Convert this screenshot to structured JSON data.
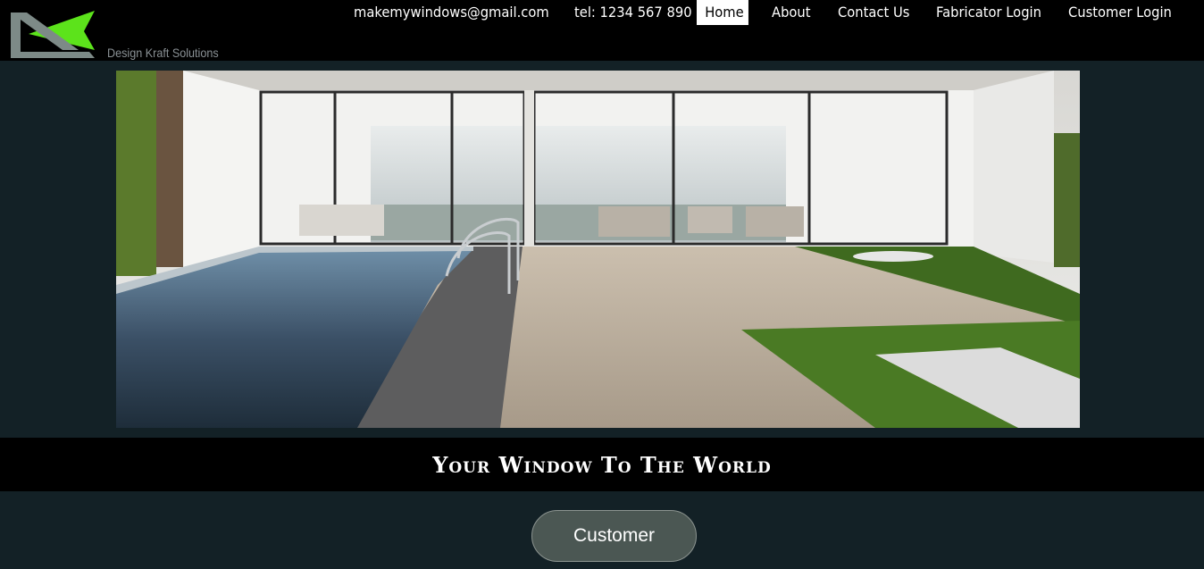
{
  "brand": {
    "name": "Design Kraft Solutions",
    "icon": "dk-logo-icon",
    "colors": {
      "accent": "#5ce31b",
      "grey": "#7d8a87"
    }
  },
  "nav": {
    "email": "makemywindows@gmail.com",
    "phone": "tel: 1234 567 890",
    "home": "Home",
    "about": "About",
    "contact": "Contact Us",
    "fabricator_login": "Fabricator Login",
    "customer_login": "Customer Login"
  },
  "hero": {
    "image": "poolside-villa-photo"
  },
  "banner": {
    "tagline": "Your Window To The World"
  },
  "cta": {
    "label": "Customer"
  }
}
